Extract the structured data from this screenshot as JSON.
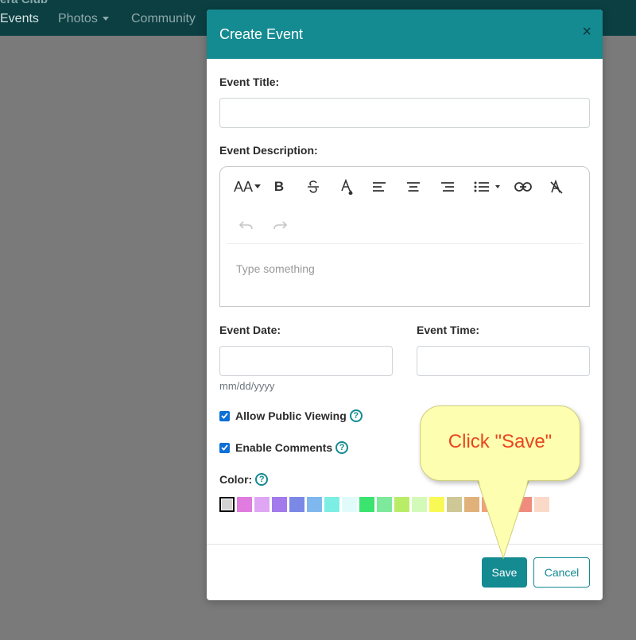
{
  "navbar": {
    "brand": "era Club",
    "items": [
      {
        "label": "Events",
        "active": true
      },
      {
        "label": "Photos",
        "active": false,
        "dropdown": true
      },
      {
        "label": "Community",
        "active": false
      }
    ]
  },
  "modal": {
    "title": "Create Event",
    "close_icon": "×",
    "event_title_label": "Event Title:",
    "event_title_value": "",
    "event_description_label": "Event Description:",
    "editor": {
      "placeholder": "Type something",
      "tools": [
        "font-size-icon",
        "bold-icon",
        "strikethrough-icon",
        "text-color-icon",
        "align-left-icon",
        "align-center-icon",
        "align-right-icon",
        "list-icon",
        "link-icon",
        "clear-format-icon",
        "undo-icon",
        "redo-icon"
      ],
      "font_size_glyph": "AA",
      "bold_glyph": "B"
    },
    "event_date_label": "Event Date:",
    "event_date_value": "",
    "event_date_hint": "mm/dd/yyyy",
    "event_time_label": "Event Time:",
    "event_time_value": "",
    "allow_public_label": "Allow Public Viewing",
    "allow_public_checked": true,
    "enable_comments_label": "Enable Comments",
    "enable_comments_checked": true,
    "help_glyph": "?",
    "color_label": "Color:",
    "colors": [
      "#d3d3d3",
      "#e07be0",
      "#dfa6f4",
      "#a27aeb",
      "#7a88e6",
      "#7fb8ef",
      "#7deee3",
      "#e1fbfb",
      "#3ae46e",
      "#7ce99b",
      "#b9ed68",
      "#d4fab9",
      "#f9f956",
      "#cec896",
      "#e0b27a",
      "#f0a07a",
      "#e8707a",
      "#ef8c7d",
      "#fbd9c9"
    ],
    "selected_color": "#d3d3d3",
    "save_label": "Save",
    "cancel_label": "Cancel"
  },
  "callout": {
    "text": "Click \"Save\""
  },
  "theme": {
    "accent": "#148a91",
    "overlay": "#7a7a7a",
    "callout_bg": "#fefeb0",
    "callout_text": "#e8471f"
  }
}
